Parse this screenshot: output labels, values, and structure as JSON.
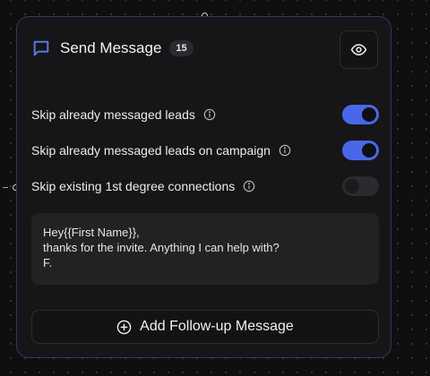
{
  "node": {
    "title": "Send Message",
    "count_badge": "15",
    "icons": {
      "message": "message-square-icon",
      "preview": "eye-icon",
      "info": "info-icon",
      "add": "plus-circle-icon"
    }
  },
  "settings": [
    {
      "label": "Skip already messaged leads",
      "enabled": true
    },
    {
      "label": "Skip already messaged leads on campaign",
      "enabled": true
    },
    {
      "label": "Skip existing 1st degree connections",
      "enabled": false
    }
  ],
  "message": {
    "lines": [
      "Hey{{First Name}},",
      "thanks for the invite. Anything I can help with?",
      "F."
    ]
  },
  "actions": {
    "add_followup_label": "Add Follow-up Message"
  },
  "colors": {
    "accent": "#4a67e8",
    "card_border": "#2e3a5c",
    "background": "#0f0f10"
  }
}
